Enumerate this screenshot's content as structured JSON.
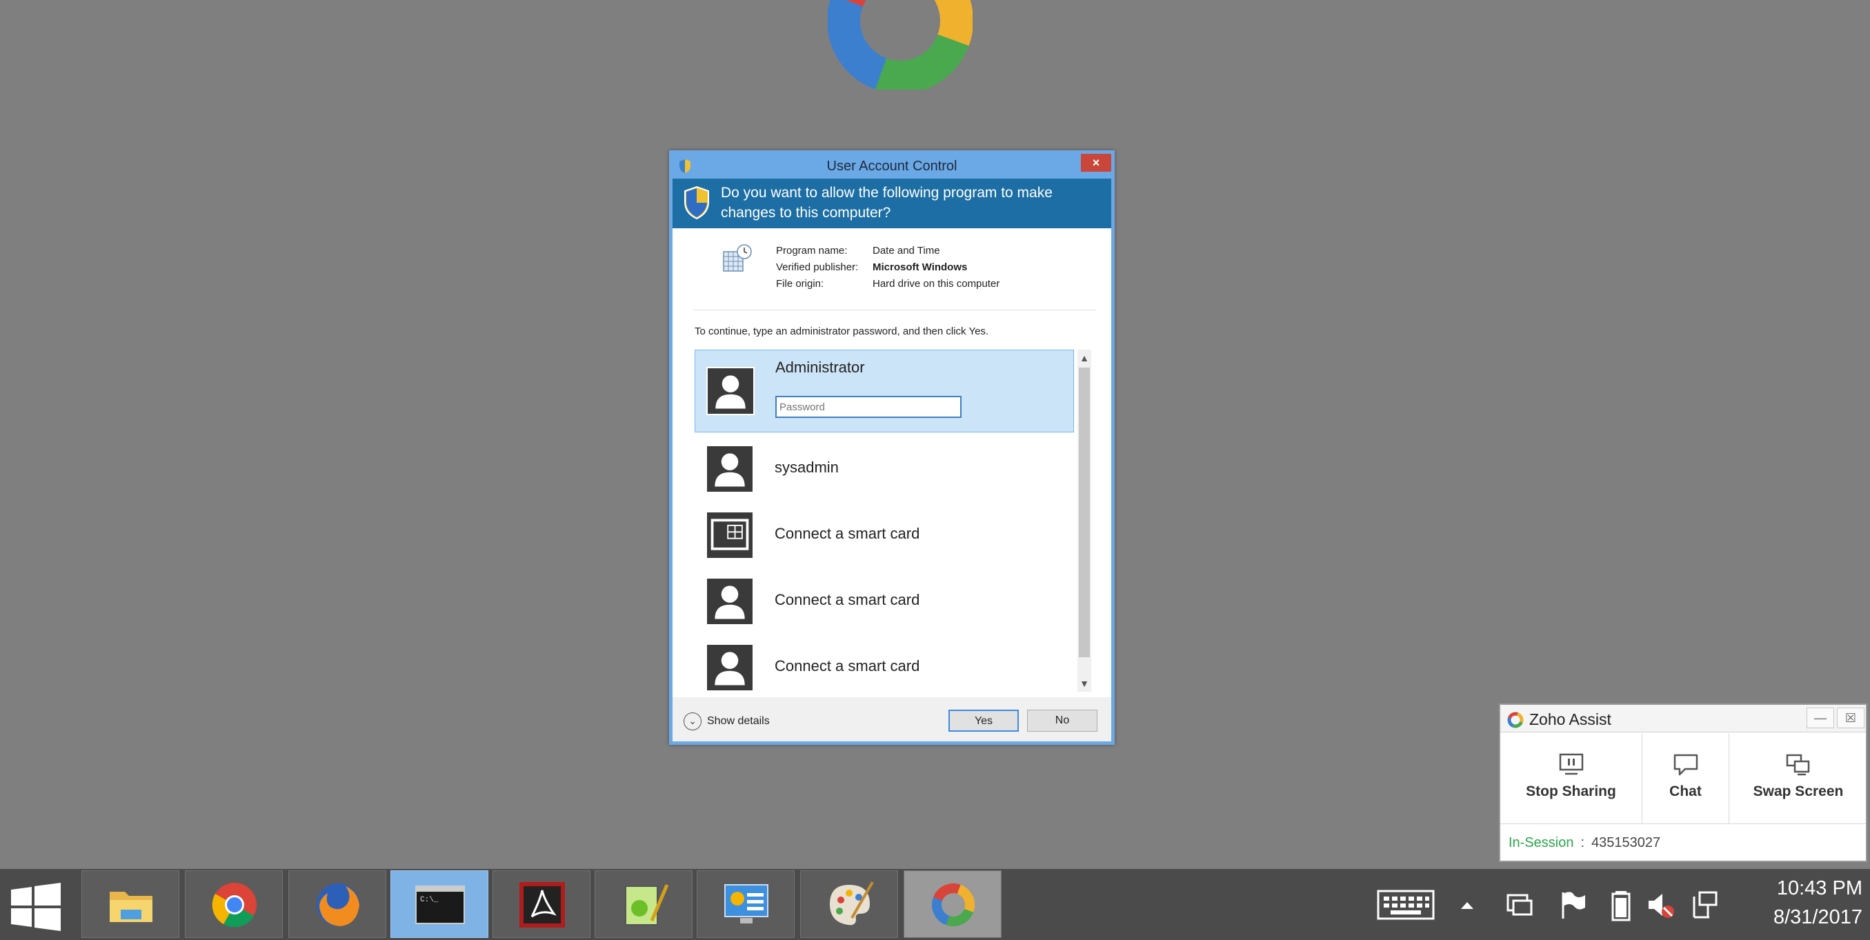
{
  "uac": {
    "title": "User Account Control",
    "close": "×",
    "question": "Do you want to allow the following program to make changes to this computer?",
    "program_name_key": "Program name:",
    "program_name_val": "Date and Time",
    "publisher_key": "Verified publisher:",
    "publisher_val": "Microsoft Windows",
    "origin_key": "File origin:",
    "origin_val": "Hard drive on this computer",
    "instruction": "To continue, type an administrator password, and then click Yes.",
    "accounts": [
      {
        "label": "Administrator"
      },
      {
        "label": "sysadmin"
      },
      {
        "label": "Connect a smart card"
      },
      {
        "label": "Connect a smart card"
      },
      {
        "label": "Connect a smart card"
      }
    ],
    "password_placeholder": "Password",
    "show_details": "Show details",
    "yes": "Yes",
    "no": "No"
  },
  "zoho": {
    "title": "Zoho Assist",
    "stop_sharing": "Stop Sharing",
    "chat": "Chat",
    "swap_screen": "Swap Screen",
    "status_label": "In-Session",
    "status_sep": ":",
    "session_id": "435153027"
  },
  "taskbar": {
    "apps": [
      "file-explorer",
      "chrome",
      "firefox",
      "command-prompt",
      "acrobat-reader",
      "notepad-plus-plus",
      "control-panel",
      "paint",
      "zoho-assist"
    ],
    "time": "10:43 PM",
    "date": "8/31/2017"
  },
  "colors": {
    "desktop": "#7f7f7f",
    "uac_border": "#6aa8e6",
    "uac_header": "#1c6ea4",
    "selected": "#cce4f7",
    "zoho_green": "#2aa84a",
    "taskbar": "#4b4b4b"
  }
}
